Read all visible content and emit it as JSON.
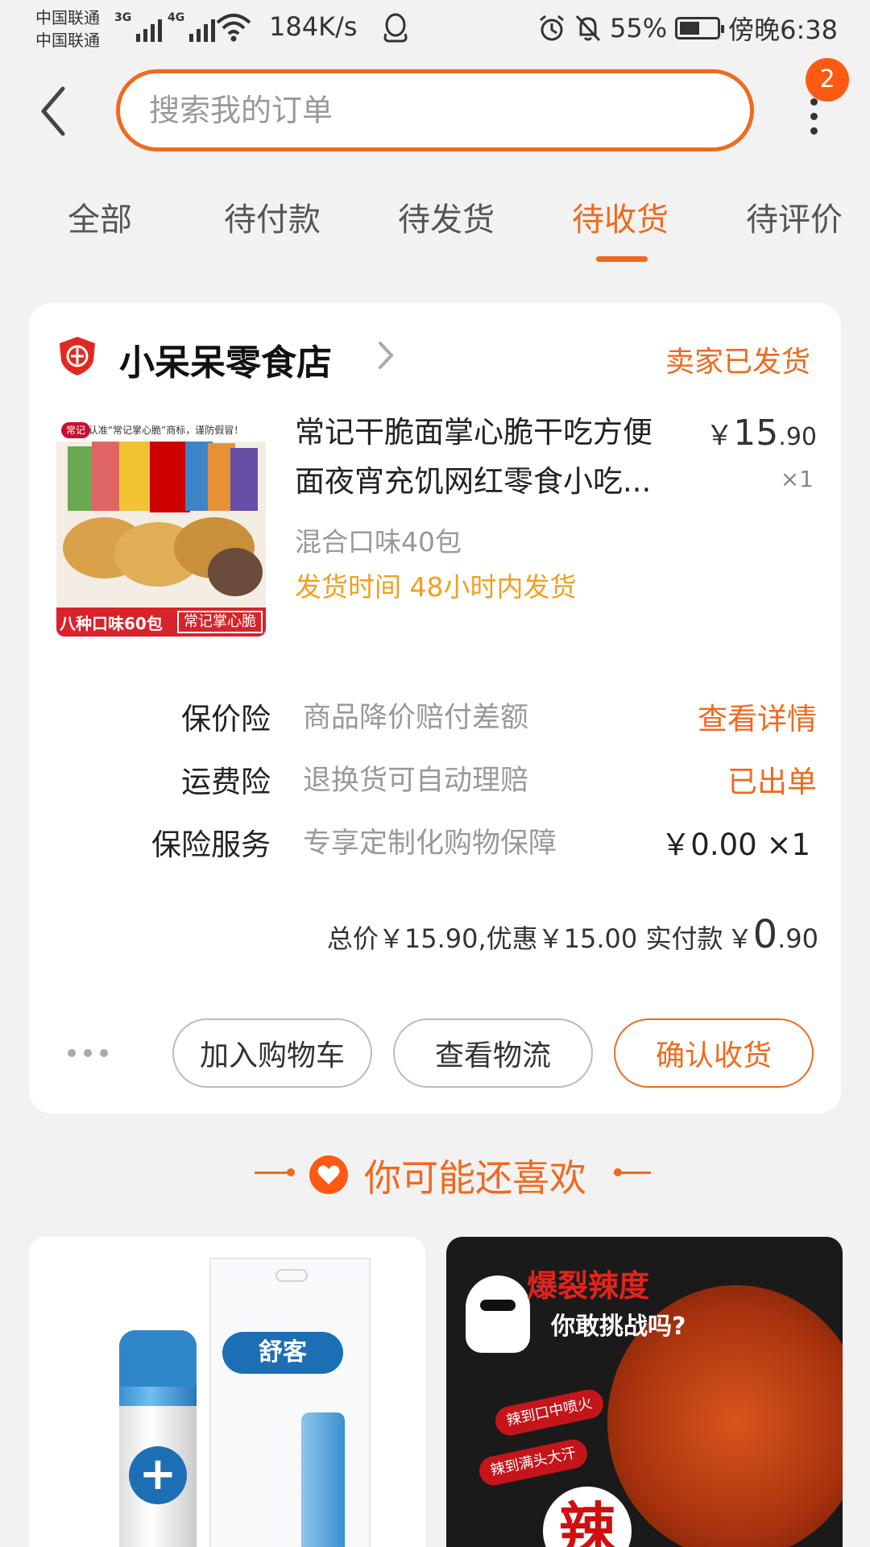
{
  "status_bar": {
    "carrier_1": "中国联通",
    "carrier_2": "中国联通",
    "signal_1_tag": "3G",
    "signal_2_tag": "4G",
    "net_speed": "184K/s",
    "battery": "55%",
    "battery_level": 0.55,
    "time": "傍晚6:38",
    "icons": [
      "signal-icon",
      "wifi-icon",
      "qq-icon",
      "alarm-icon",
      "mute-icon",
      "battery-icon"
    ]
  },
  "header": {
    "search_placeholder": "搜索我的订单",
    "more_badge": "2"
  },
  "tabs": [
    {
      "label": "全部"
    },
    {
      "label": "待付款"
    },
    {
      "label": "待发货"
    },
    {
      "label": "待收货",
      "active": true
    },
    {
      "label": "待评价"
    }
  ],
  "order": {
    "shop_name": "小呆呆零食店",
    "status": "卖家已发货",
    "product": {
      "title_line1": "常记干脆面掌心脆干吃方便",
      "title_line2": "面夜宵充饥网红零食小吃...",
      "price_symbol": "￥",
      "price_int": "15",
      "price_dec": ".90",
      "quantity": "×1",
      "variant": "混合口味40包",
      "ship_time": "发货时间 48小时内发货",
      "thumb_top_text": "请认准“常记掌心脆”商标，谨防假冒！",
      "thumb_brand": "常记",
      "thumb_bottom_left": "八种口味60包",
      "thumb_bottom_right": "常记掌心脆"
    },
    "insurance": [
      {
        "label": "保价险",
        "desc": "商品降价赔付差额",
        "action": "查看详情"
      },
      {
        "label": "运费险",
        "desc": "退换货可自动理赔",
        "action": "已出单"
      },
      {
        "label": "保险服务",
        "desc": "专享定制化购物保障",
        "value": "￥0.00 ×1"
      }
    ],
    "total": {
      "summary": "总价￥15.90,优惠￥15.00 实付款",
      "paid_symbol": "￥",
      "paid_int": "0",
      "paid_dec": ".90"
    },
    "buttons": {
      "add_cart": "加入购物车",
      "logistics": "查看物流",
      "confirm": "确认收货"
    }
  },
  "recommend": {
    "title": "你可能还喜欢",
    "item1": {
      "brand": "舒客",
      "plus": "+"
    },
    "item2": {
      "headline": "爆裂辣度",
      "subline": "你敢挑战吗?",
      "tag1": "辣到口中喷火",
      "tag2": "辣到满头大汗",
      "big": "辣"
    }
  },
  "colors": {
    "accent": "#ef6a1f",
    "badge": "#ff5a13",
    "ship_time": "#f0a020"
  }
}
